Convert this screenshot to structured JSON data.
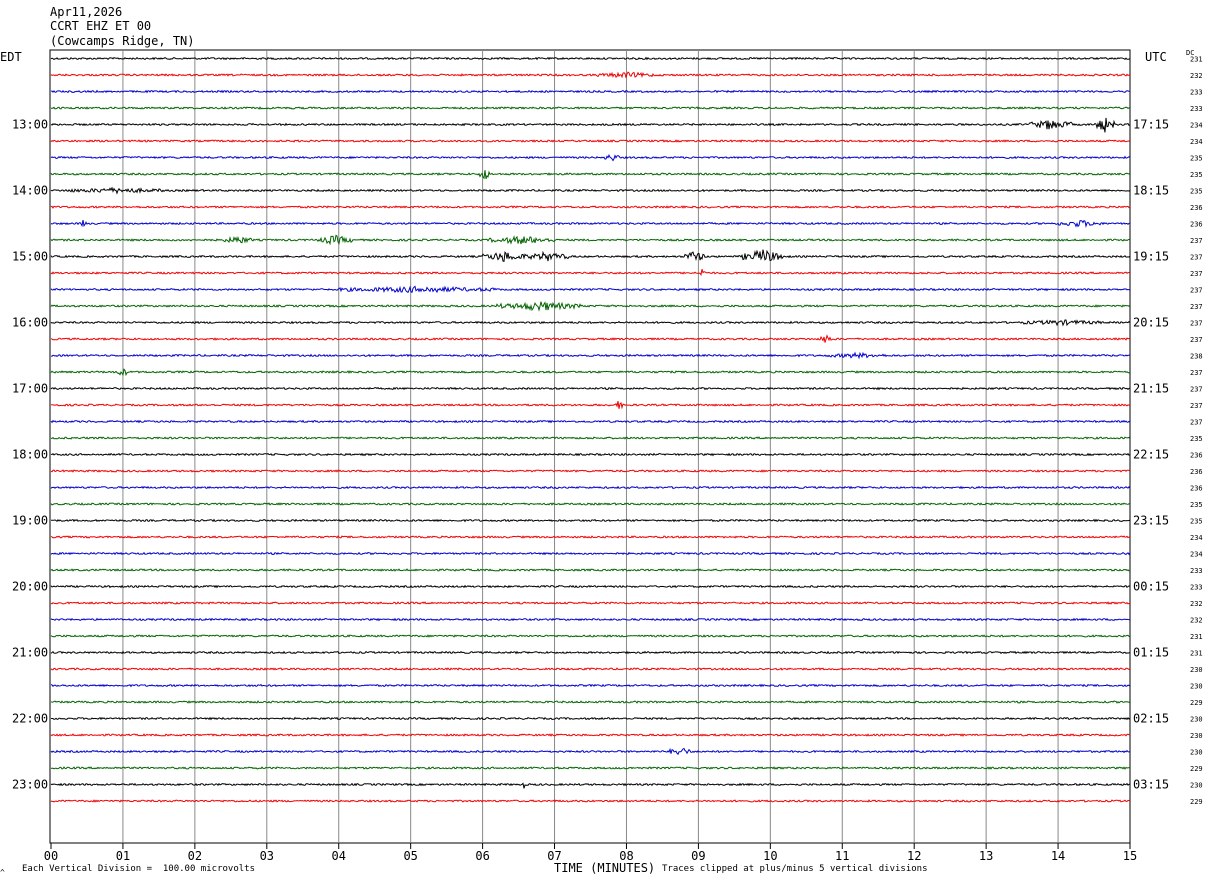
{
  "header": {
    "date": "Apr11,2026",
    "station": "CCRT EHZ ET 00",
    "location": "(Cowcamps Ridge, TN)"
  },
  "left_axis_label": "EDT",
  "right_axis_label": "UTC",
  "dc_label": "DC",
  "footer": {
    "scale": "Each Vertical Division =  100.00 microvolts",
    "xlabel": "TIME (MINUTES)",
    "clip": "Traces clipped at plus/minus 5 vertical divisions",
    "mark": "^"
  },
  "colors": {
    "trace_cycle": [
      "#000000",
      "#ee0000",
      "#0000cc",
      "#006400"
    ],
    "grid": "#888888",
    "frame": "#000000"
  },
  "chart_data": {
    "type": "line",
    "title": "",
    "xlabel": "TIME (MINUTES)",
    "x_ticks": [
      "00",
      "01",
      "02",
      "03",
      "04",
      "05",
      "06",
      "07",
      "08",
      "09",
      "10",
      "11",
      "12",
      "13",
      "14",
      "15"
    ],
    "xlim": [
      0,
      15
    ],
    "traces_per_hour": 4,
    "left_hour_labels": [
      "13:00",
      "14:00",
      "15:00",
      "16:00",
      "17:00",
      "18:00",
      "19:00",
      "20:00",
      "21:00",
      "22:00",
      "23:00"
    ],
    "right_hour_labels": [
      "17:15",
      "18:15",
      "19:15",
      "20:15",
      "21:15",
      "22:15",
      "23:15",
      "00:15",
      "01:15",
      "02:15",
      "03:15"
    ],
    "first_labeled_trace_index": 4,
    "dc_values": [
      231,
      232,
      233,
      233,
      234,
      234,
      235,
      235,
      235,
      236,
      236,
      237,
      237,
      237,
      237,
      237,
      237,
      237,
      238,
      237,
      237,
      237,
      237,
      235,
      236,
      236,
      236,
      235,
      235,
      234,
      234,
      233,
      233,
      232,
      232,
      231,
      231,
      230,
      230,
      229,
      230,
      230,
      230,
      229,
      230,
      229
    ],
    "events": [
      {
        "trace": 4,
        "minute_start": 13.6,
        "minute_end": 14.2,
        "amplitude": 3.0
      },
      {
        "trace": 4,
        "minute_start": 14.5,
        "minute_end": 14.8,
        "amplitude": 4.5
      },
      {
        "trace": 1,
        "minute_start": 7.6,
        "minute_end": 8.4,
        "amplitude": 1.4
      },
      {
        "trace": 6,
        "minute_start": 7.7,
        "minute_end": 7.9,
        "amplitude": 2.0
      },
      {
        "trace": 7,
        "minute_start": 5.95,
        "minute_end": 6.1,
        "amplitude": 4.0
      },
      {
        "trace": 8,
        "minute_start": 0.2,
        "minute_end": 1.6,
        "amplitude": 1.2
      },
      {
        "trace": 10,
        "minute_start": 0.42,
        "minute_end": 0.5,
        "amplitude": 4.0
      },
      {
        "trace": 10,
        "minute_start": 14.0,
        "minute_end": 14.6,
        "amplitude": 1.8
      },
      {
        "trace": 11,
        "minute_start": 2.4,
        "minute_end": 2.8,
        "amplitude": 2.0
      },
      {
        "trace": 11,
        "minute_start": 3.7,
        "minute_end": 4.2,
        "amplitude": 2.5
      },
      {
        "trace": 11,
        "minute_start": 6.1,
        "minute_end": 7.0,
        "amplitude": 2.2
      },
      {
        "trace": 12,
        "minute_start": 6.0,
        "minute_end": 6.6,
        "amplitude": 3.0
      },
      {
        "trace": 12,
        "minute_start": 6.6,
        "minute_end": 7.2,
        "amplitude": 2.5
      },
      {
        "trace": 12,
        "minute_start": 8.8,
        "minute_end": 9.1,
        "amplitude": 3.5
      },
      {
        "trace": 12,
        "minute_start": 9.6,
        "minute_end": 10.2,
        "amplitude": 4.0
      },
      {
        "trace": 13,
        "minute_start": 9.0,
        "minute_end": 9.1,
        "amplitude": 2.5
      },
      {
        "trace": 14,
        "minute_start": 4.0,
        "minute_end": 6.2,
        "amplitude": 1.5
      },
      {
        "trace": 15,
        "minute_start": 6.2,
        "minute_end": 7.4,
        "amplitude": 2.5
      },
      {
        "trace": 16,
        "minute_start": 13.5,
        "minute_end": 14.6,
        "amplitude": 1.2
      },
      {
        "trace": 17,
        "minute_start": 10.7,
        "minute_end": 10.85,
        "amplitude": 3.0
      },
      {
        "trace": 18,
        "minute_start": 10.8,
        "minute_end": 11.6,
        "amplitude": 1.2
      },
      {
        "trace": 19,
        "minute_start": 0.9,
        "minute_end": 1.1,
        "amplitude": 2.0
      },
      {
        "trace": 21,
        "minute_start": 7.85,
        "minute_end": 7.95,
        "amplitude": 3.0
      },
      {
        "trace": 42,
        "minute_start": 8.6,
        "minute_end": 8.9,
        "amplitude": 2.5
      },
      {
        "trace": 44,
        "minute_start": 6.55,
        "minute_end": 6.6,
        "amplitude": 2.0
      }
    ]
  }
}
